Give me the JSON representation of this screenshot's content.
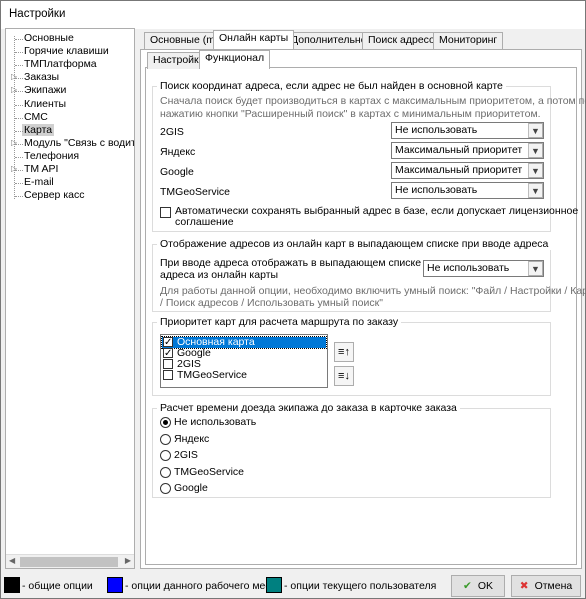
{
  "window": {
    "title": "Настройки"
  },
  "tree": {
    "items": [
      {
        "label": "Основные",
        "expandable": false
      },
      {
        "label": "Горячие клавиши",
        "expandable": false
      },
      {
        "label": "ТМПлатформа",
        "expandable": false
      },
      {
        "label": "Заказы",
        "expandable": true
      },
      {
        "label": "Экипажи",
        "expandable": true
      },
      {
        "label": "Клиенты",
        "expandable": false
      },
      {
        "label": "СМС",
        "expandable": false
      },
      {
        "label": "Карта",
        "expandable": false,
        "selected": true
      },
      {
        "label": "Модуль \"Связь с водителя",
        "expandable": true
      },
      {
        "label": "Телефония",
        "expandable": false
      },
      {
        "label": "TM API",
        "expandable": true
      },
      {
        "label": "E-mail",
        "expandable": false
      },
      {
        "label": "Сервер касс",
        "expandable": false
      }
    ]
  },
  "tabs": [
    "Основные (mp)",
    "Онлайн карты",
    "Дополнительно",
    "Поиск адресов",
    "Мониторинг"
  ],
  "subtabs": [
    "Настройки",
    "Функционал"
  ],
  "search_group": {
    "title": "Поиск координат адреса, если адрес не был найден в основной карте",
    "hint_line1": "Сначала поиск будет производиться в картах с максимальным приоритетом, а потом по",
    "hint_line2": "нажатию кнопки \"Расширенный поиск\" в картах с минимальным приоритетом.",
    "rows": [
      {
        "label": "2GIS",
        "value": "Не использовать"
      },
      {
        "label": "Яндекс",
        "value": "Максимальный приоритет"
      },
      {
        "label": "Google",
        "value": "Максимальный приоритет"
      },
      {
        "label": "TMGeoService",
        "value": "Не использовать"
      }
    ],
    "autosave_line1": "Автоматически сохранять выбранный адрес в базе, если допускает лицензионное",
    "autosave_line2": "соглашение",
    "autosave_checked": false
  },
  "display_group": {
    "title": "Отображение адресов из онлайн карт в выпадающем списке при вводе адреса",
    "label_line1": "При вводе адреса отображать в выпадающем списке",
    "label_line2": "адреса из онлайн карты",
    "value": "Не использовать",
    "hint_line1": "Для работы данной опции, необходимо включить умный поиск: \"Файл / Настройки / Карта",
    "hint_line2": "/ Поиск адресов / Использовать умный поиск\""
  },
  "priority_group": {
    "title": "Приоритет карт для расчета маршрута по заказу",
    "items": [
      {
        "label": "Основная карта",
        "checked": true,
        "selected": true
      },
      {
        "label": "Google",
        "checked": true,
        "selected": false
      },
      {
        "label": "2GIS",
        "checked": false,
        "selected": false
      },
      {
        "label": "TMGeoService",
        "checked": false,
        "selected": false
      }
    ]
  },
  "time_group": {
    "title": "Расчет времени доезда экипажа до заказа в карточке заказа",
    "options": [
      {
        "label": "Не использовать",
        "checked": true
      },
      {
        "label": "Яндекс",
        "checked": false
      },
      {
        "label": "2GIS",
        "checked": false
      },
      {
        "label": "TMGeoService",
        "checked": false
      },
      {
        "label": "Google",
        "checked": false
      }
    ]
  },
  "footer": {
    "legend": [
      {
        "label": "- общие опции",
        "color": "#000000"
      },
      {
        "label": "- опции данного рабочего места",
        "color": "#0000ff"
      },
      {
        "label": "- опции текущего пользователя",
        "color": "#008080"
      }
    ],
    "ok_label": "OK",
    "cancel_label": "Отмена"
  }
}
